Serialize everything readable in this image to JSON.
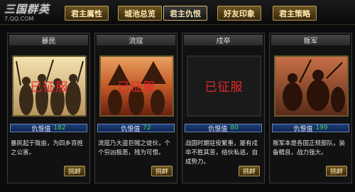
{
  "logo": {
    "name": "三国群英",
    "site": "7.QQ.COM"
  },
  "tabs": [
    {
      "label": "君主属性"
    },
    {
      "label": "城池总览"
    },
    {
      "label": "君主仇恨"
    },
    {
      "label": "好友印象"
    },
    {
      "label": "君主策略"
    }
  ],
  "active_tab": "君主仇恨",
  "stamp_text": "已征服",
  "hate_label": "仇恨值",
  "attack_label": "挑衅",
  "panels": [
    {
      "title": "暴民",
      "hate": "182",
      "desc": "暴民起于陇亩，为四乡百姓之公害。"
    },
    {
      "title": "流寇",
      "hate": "72",
      "desc": "流寇乃大盗巨贼之徒伙，个个穷凶极恶，残为可恨。"
    },
    {
      "title": "戍卒",
      "hate": "80",
      "desc": "战国时期驻役繁重，屡有戍卒不胜其苦，结伙私逃，自成势力。"
    },
    {
      "title": "叛军",
      "hate": "199",
      "desc": "叛军本是各国正规部队，装备精良，战力强大。"
    }
  ],
  "colors": {
    "stamp": "#e6262a",
    "hate_value": "#4ed060",
    "tab_gold": "#b59a5a"
  }
}
